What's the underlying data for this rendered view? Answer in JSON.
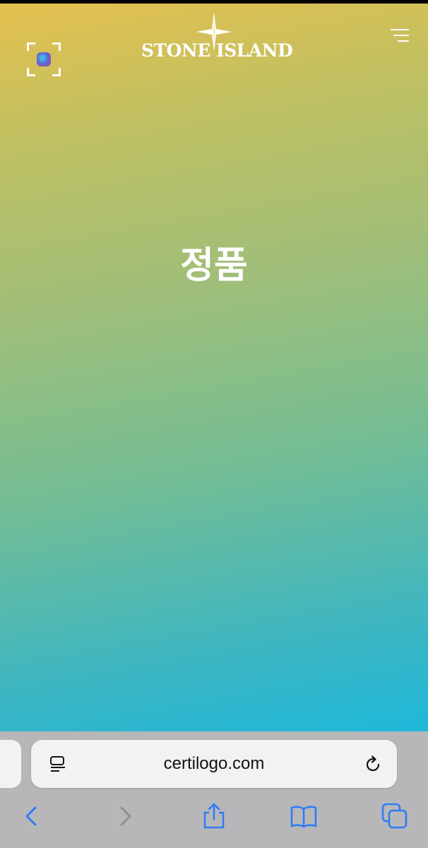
{
  "header": {
    "logo_text": "STONE ISLAND",
    "scan_icon": "scan-frame-icon",
    "menu_icon": "hamburger-menu-icon"
  },
  "main": {
    "headline": "정품"
  },
  "browser": {
    "url": "certilogo.com",
    "reader_icon": "reader-mode-icon",
    "reload_icon": "reload-icon",
    "toolbar": [
      "back-icon",
      "forward-icon",
      "share-icon",
      "bookmarks-icon",
      "tabs-icon"
    ]
  },
  "colors": {
    "gradient_top": "#e5c04f",
    "gradient_bottom": "#1fb7da",
    "toolbar_accent": "#2f7cf6",
    "toolbar_disabled": "#8e8e93",
    "browser_bar": "#b7b7b9"
  }
}
